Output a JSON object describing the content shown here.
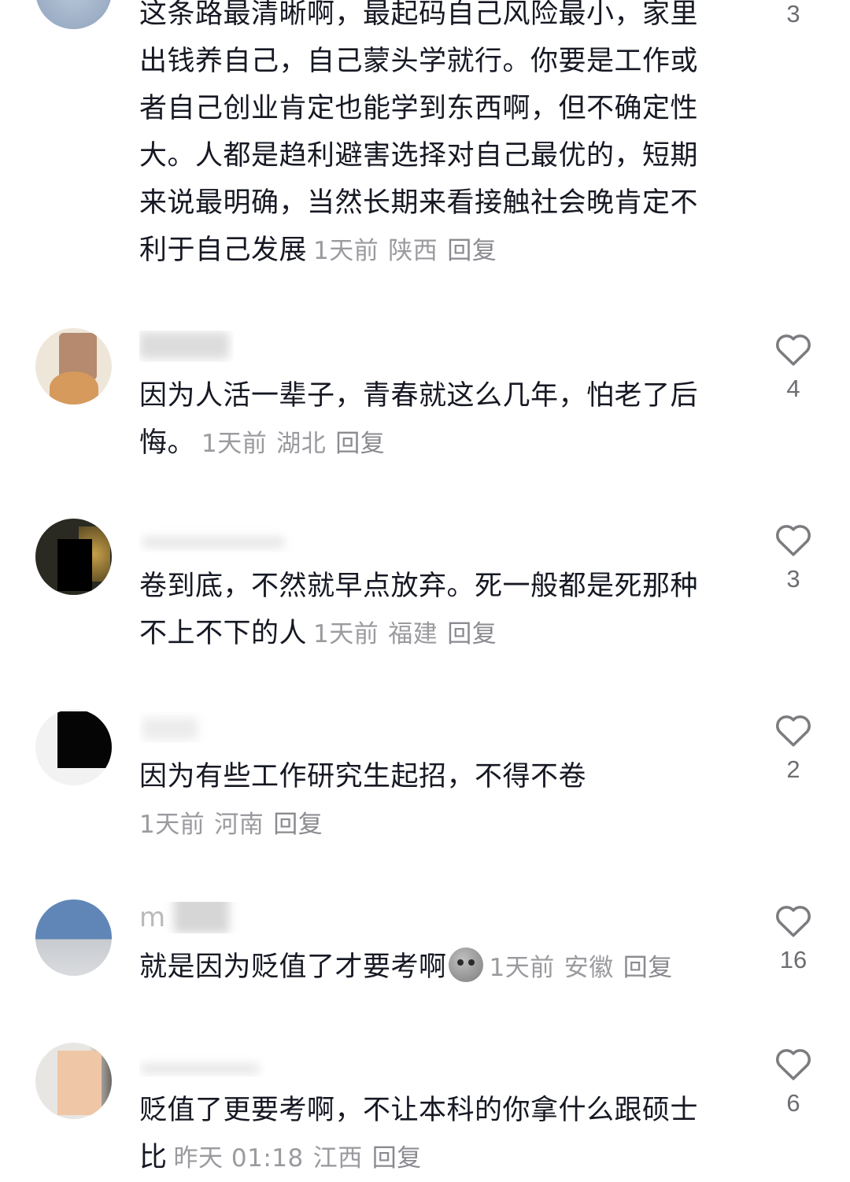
{
  "comments": [
    {
      "text": "这条路最清晰啊，最起码自己风险最小，家里出钱养自己，自己蒙头学就行。你要是工作或者自己创业肯定也能学到东西啊，但不确定性大。人都是趋利避害选择对自己最优的，短期来说最明确，当然长期来看接触社会晚肯定不利于自己发展",
      "time": "1天前",
      "location": "陕西",
      "reply_label": "回复",
      "likes": "3"
    },
    {
      "username": "",
      "text": "因为人活一辈子，青春就这么几年，怕老了后悔。",
      "time": "1天前",
      "location": "湖北",
      "reply_label": "回复",
      "likes": "4"
    },
    {
      "username": "",
      "text": "卷到底，不然就早点放弃。死一般都是死那种不上不下的人",
      "time": "1天前",
      "location": "福建",
      "reply_label": "回复",
      "likes": "3"
    },
    {
      "username": "",
      "text": "因为有些工作研究生起招，不得不卷",
      "time": "1天前",
      "location": "河南",
      "reply_label": "回复",
      "likes": "2"
    },
    {
      "username": "m",
      "text": "就是因为贬值了才要考啊",
      "time": "1天前",
      "location": "安徽",
      "reply_label": "回复",
      "likes": "16"
    },
    {
      "username": "",
      "text": "贬值了更要考啊，不让本科的你拿什么跟硕士比",
      "time": "昨天 01:18",
      "location": "江西",
      "reply_label": "回复",
      "likes": "6"
    }
  ],
  "icons": {
    "like": "heart-outline-icon",
    "emoji": "pensive-face-emoji-icon"
  },
  "colors": {
    "text": "#161823",
    "meta": "#9a9a9f",
    "like_count": "#6d6d72"
  }
}
